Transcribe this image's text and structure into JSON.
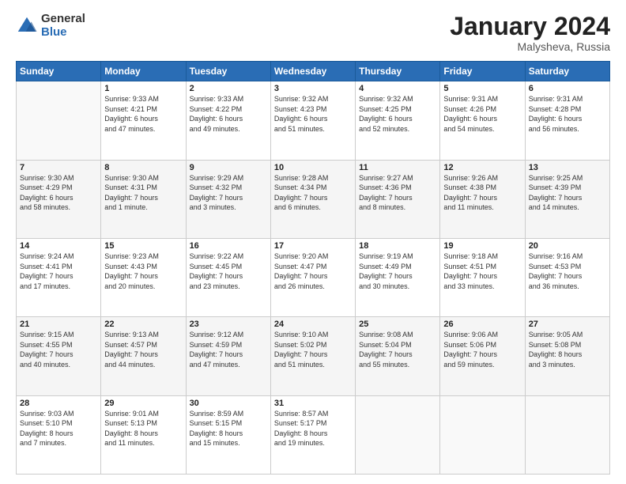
{
  "header": {
    "logo": {
      "general": "General",
      "blue": "Blue"
    },
    "title": "January 2024",
    "subtitle": "Malysheva, Russia"
  },
  "days_of_week": [
    "Sunday",
    "Monday",
    "Tuesday",
    "Wednesday",
    "Thursday",
    "Friday",
    "Saturday"
  ],
  "weeks": [
    [
      {
        "day": "",
        "info": ""
      },
      {
        "day": "1",
        "info": "Sunrise: 9:33 AM\nSunset: 4:21 PM\nDaylight: 6 hours\nand 47 minutes."
      },
      {
        "day": "2",
        "info": "Sunrise: 9:33 AM\nSunset: 4:22 PM\nDaylight: 6 hours\nand 49 minutes."
      },
      {
        "day": "3",
        "info": "Sunrise: 9:32 AM\nSunset: 4:23 PM\nDaylight: 6 hours\nand 51 minutes."
      },
      {
        "day": "4",
        "info": "Sunrise: 9:32 AM\nSunset: 4:25 PM\nDaylight: 6 hours\nand 52 minutes."
      },
      {
        "day": "5",
        "info": "Sunrise: 9:31 AM\nSunset: 4:26 PM\nDaylight: 6 hours\nand 54 minutes."
      },
      {
        "day": "6",
        "info": "Sunrise: 9:31 AM\nSunset: 4:28 PM\nDaylight: 6 hours\nand 56 minutes."
      }
    ],
    [
      {
        "day": "7",
        "info": "Sunrise: 9:30 AM\nSunset: 4:29 PM\nDaylight: 6 hours\nand 58 minutes."
      },
      {
        "day": "8",
        "info": "Sunrise: 9:30 AM\nSunset: 4:31 PM\nDaylight: 7 hours\nand 1 minute."
      },
      {
        "day": "9",
        "info": "Sunrise: 9:29 AM\nSunset: 4:32 PM\nDaylight: 7 hours\nand 3 minutes."
      },
      {
        "day": "10",
        "info": "Sunrise: 9:28 AM\nSunset: 4:34 PM\nDaylight: 7 hours\nand 6 minutes."
      },
      {
        "day": "11",
        "info": "Sunrise: 9:27 AM\nSunset: 4:36 PM\nDaylight: 7 hours\nand 8 minutes."
      },
      {
        "day": "12",
        "info": "Sunrise: 9:26 AM\nSunset: 4:38 PM\nDaylight: 7 hours\nand 11 minutes."
      },
      {
        "day": "13",
        "info": "Sunrise: 9:25 AM\nSunset: 4:39 PM\nDaylight: 7 hours\nand 14 minutes."
      }
    ],
    [
      {
        "day": "14",
        "info": "Sunrise: 9:24 AM\nSunset: 4:41 PM\nDaylight: 7 hours\nand 17 minutes."
      },
      {
        "day": "15",
        "info": "Sunrise: 9:23 AM\nSunset: 4:43 PM\nDaylight: 7 hours\nand 20 minutes."
      },
      {
        "day": "16",
        "info": "Sunrise: 9:22 AM\nSunset: 4:45 PM\nDaylight: 7 hours\nand 23 minutes."
      },
      {
        "day": "17",
        "info": "Sunrise: 9:20 AM\nSunset: 4:47 PM\nDaylight: 7 hours\nand 26 minutes."
      },
      {
        "day": "18",
        "info": "Sunrise: 9:19 AM\nSunset: 4:49 PM\nDaylight: 7 hours\nand 30 minutes."
      },
      {
        "day": "19",
        "info": "Sunrise: 9:18 AM\nSunset: 4:51 PM\nDaylight: 7 hours\nand 33 minutes."
      },
      {
        "day": "20",
        "info": "Sunrise: 9:16 AM\nSunset: 4:53 PM\nDaylight: 7 hours\nand 36 minutes."
      }
    ],
    [
      {
        "day": "21",
        "info": "Sunrise: 9:15 AM\nSunset: 4:55 PM\nDaylight: 7 hours\nand 40 minutes."
      },
      {
        "day": "22",
        "info": "Sunrise: 9:13 AM\nSunset: 4:57 PM\nDaylight: 7 hours\nand 44 minutes."
      },
      {
        "day": "23",
        "info": "Sunrise: 9:12 AM\nSunset: 4:59 PM\nDaylight: 7 hours\nand 47 minutes."
      },
      {
        "day": "24",
        "info": "Sunrise: 9:10 AM\nSunset: 5:02 PM\nDaylight: 7 hours\nand 51 minutes."
      },
      {
        "day": "25",
        "info": "Sunrise: 9:08 AM\nSunset: 5:04 PM\nDaylight: 7 hours\nand 55 minutes."
      },
      {
        "day": "26",
        "info": "Sunrise: 9:06 AM\nSunset: 5:06 PM\nDaylight: 7 hours\nand 59 minutes."
      },
      {
        "day": "27",
        "info": "Sunrise: 9:05 AM\nSunset: 5:08 PM\nDaylight: 8 hours\nand 3 minutes."
      }
    ],
    [
      {
        "day": "28",
        "info": "Sunrise: 9:03 AM\nSunset: 5:10 PM\nDaylight: 8 hours\nand 7 minutes."
      },
      {
        "day": "29",
        "info": "Sunrise: 9:01 AM\nSunset: 5:13 PM\nDaylight: 8 hours\nand 11 minutes."
      },
      {
        "day": "30",
        "info": "Sunrise: 8:59 AM\nSunset: 5:15 PM\nDaylight: 8 hours\nand 15 minutes."
      },
      {
        "day": "31",
        "info": "Sunrise: 8:57 AM\nSunset: 5:17 PM\nDaylight: 8 hours\nand 19 minutes."
      },
      {
        "day": "",
        "info": ""
      },
      {
        "day": "",
        "info": ""
      },
      {
        "day": "",
        "info": ""
      }
    ]
  ]
}
